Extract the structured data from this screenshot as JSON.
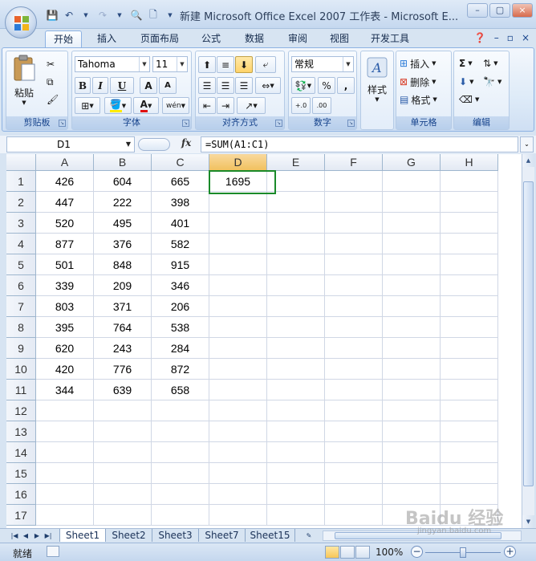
{
  "window": {
    "title": "新建 Microsoft Office Excel 2007 工作表 - Microsoft E...",
    "controls": [
      "?",
      "–",
      "▢",
      "×"
    ]
  },
  "tabs": [
    "开始",
    "插入",
    "页面布局",
    "公式",
    "数据",
    "审阅",
    "视图",
    "开发工具"
  ],
  "ribbon": {
    "clipboard": {
      "paste": "粘贴",
      "label": "剪贴板"
    },
    "font": {
      "name": "Tahoma",
      "size": "11",
      "label": "字体",
      "bold": "B",
      "italic": "I",
      "underline": "U",
      "grow": "A",
      "shrink": "A",
      "phonetic": "wén"
    },
    "alignment": {
      "label": "对齐方式"
    },
    "number": {
      "format": "常规",
      "percent": "%",
      "comma": ",",
      "inc": "+.0",
      "dec": ".00",
      "label": "数字"
    },
    "styles": {
      "button": "样式"
    },
    "cells": {
      "insert": "插入",
      "delete": "删除",
      "format": "格式",
      "label": "单元格"
    },
    "editing": {
      "sum": "Σ",
      "label": "编辑"
    }
  },
  "formula_bar": {
    "name_box": "D1",
    "fx": "fx",
    "formula": "=SUM(A1:C1)"
  },
  "grid": {
    "columns": [
      "A",
      "B",
      "C",
      "D",
      "E",
      "F",
      "G",
      "H"
    ],
    "rows": [
      "1",
      "2",
      "3",
      "4",
      "5",
      "6",
      "7",
      "8",
      "9",
      "10",
      "11",
      "12",
      "13",
      "14",
      "15",
      "16",
      "17"
    ],
    "cells": [
      [
        "426",
        "604",
        "665",
        "1695"
      ],
      [
        "447",
        "222",
        "398",
        ""
      ],
      [
        "520",
        "495",
        "401",
        ""
      ],
      [
        "877",
        "376",
        "582",
        ""
      ],
      [
        "501",
        "848",
        "915",
        ""
      ],
      [
        "339",
        "209",
        "346",
        ""
      ],
      [
        "803",
        "371",
        "206",
        ""
      ],
      [
        "395",
        "764",
        "538",
        ""
      ],
      [
        "620",
        "243",
        "284",
        ""
      ],
      [
        "420",
        "776",
        "872",
        ""
      ],
      [
        "344",
        "639",
        "658",
        ""
      ]
    ],
    "active_cell": "D1"
  },
  "sheets": [
    "Sheet1",
    "Sheet2",
    "Sheet3",
    "Sheet7",
    "Sheet15"
  ],
  "active_sheet": "Sheet1",
  "status": {
    "mode": "就绪",
    "zoom": "100%"
  },
  "watermark": {
    "text": "Baidu 经验",
    "sub": "jingyan.baidu.com"
  },
  "colors": {
    "accent": "#1a8a2a",
    "ribbon_bg": "#deebf8"
  }
}
